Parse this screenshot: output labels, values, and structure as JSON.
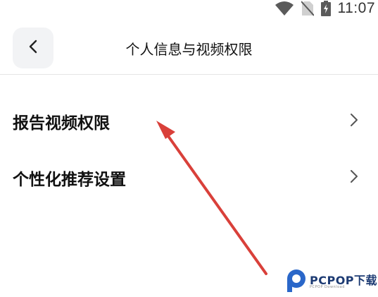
{
  "status_bar": {
    "time": "11:07",
    "icons": [
      "wifi-icon",
      "no-sim-icon",
      "battery-charging-icon"
    ]
  },
  "header": {
    "title": "个人信息与视频权限",
    "back_icon": "chevron-left-icon"
  },
  "menu": {
    "items": [
      {
        "label": "报告视频权限",
        "icon": "chevron-right-icon"
      },
      {
        "label": "个性化推荐设置",
        "icon": "chevron-right-icon"
      }
    ]
  },
  "annotation": {
    "color": "#d9403a"
  },
  "watermark": {
    "brand": "PCPOP下载",
    "sub": "PCPOP Download"
  }
}
